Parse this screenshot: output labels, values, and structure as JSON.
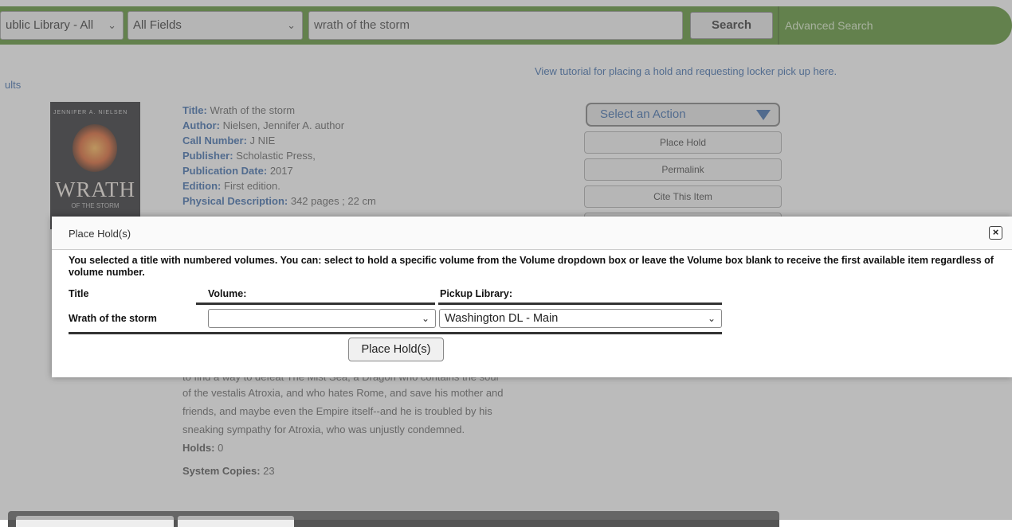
{
  "search_bar": {
    "library_select": "ublic Library - All",
    "field_select": "All Fields",
    "query": "wrath of the storm",
    "search_label": "Search",
    "advanced_label": "Advanced Search"
  },
  "page": {
    "results_link": "ults",
    "tutorial_link": "View tutorial for placing a hold and requesting locker pick up here.",
    "cover": {
      "author": "JENNIFER A. NIELSEN",
      "title_line1": "WRATH",
      "title_line2": "OF THE STORM"
    },
    "metadata": [
      {
        "label": "Title:",
        "value": "Wrath of the storm"
      },
      {
        "label": "Author:",
        "value": "Nielsen, Jennifer A. author"
      },
      {
        "label": "Call Number:",
        "value": "J NIE"
      },
      {
        "label": "Publisher:",
        "value": "Scholastic Press,"
      },
      {
        "label": "Publication Date:",
        "value": "2017"
      },
      {
        "label": "Edition:",
        "value": "First edition."
      },
      {
        "label": "Physical Description:",
        "value": "342 pages ; 22 cm"
      }
    ],
    "actions": {
      "select_label": "Select an Action",
      "place_hold": "Place Hold",
      "permalink": "Permalink",
      "cite": "Cite This Item"
    },
    "description": {
      "cut_line": "to find a way to defeat The Mist Sea, a Dragon who contains the soul",
      "line1": "of the vestalis Atroxia, and who hates Rome, and save his mother and",
      "line2": "friends, and maybe even the Empire itself--and he is troubled by his",
      "line3": "sneaking sympathy for Atroxia, who was unjustly condemned."
    },
    "holds": {
      "label": "Holds:",
      "value": "0"
    },
    "copies": {
      "label": "System Copies:",
      "value": "23"
    }
  },
  "modal": {
    "title": "Place Hold(s)",
    "close_icon": "close-icon",
    "notice": "You selected a title with numbered volumes. You can: select to hold a specific volume from the Volume dropdown box or leave the Volume box blank to receive the first available item regardless of volume number.",
    "columns": {
      "title": "Title",
      "volume": "Volume:",
      "pickup": "Pickup Library:"
    },
    "row": {
      "title": "Wrath of the storm",
      "volume": "",
      "pickup": "Washington DL - Main"
    },
    "submit_label": "Place Hold(s)"
  },
  "colors": {
    "header_green": "#4f8a22",
    "link_blue": "#2b5fa5",
    "overlay": "rgba(120,120,120,0.5)"
  }
}
